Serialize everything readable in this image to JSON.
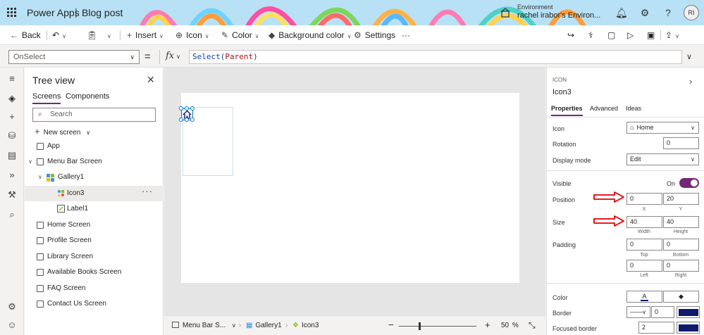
{
  "titlebar": {
    "app_name": "Power Apps",
    "separator": "|",
    "document": "Blog post",
    "environment_label": "Environment",
    "environment_name": "rachel irabor's Environ...",
    "avatar_initials": "RI"
  },
  "commandbar": {
    "back": "Back",
    "insert": "Insert",
    "icon": "Icon",
    "color": "Color",
    "background_color": "Background color",
    "settings": "Settings",
    "more": "···"
  },
  "formula_bar": {
    "property": "OnSelect",
    "equals": "=",
    "fx": "fx",
    "formula_fn": "Select(",
    "formula_arg": "Parent",
    "formula_close": ")"
  },
  "tree_view": {
    "title": "Tree view",
    "tabs": [
      "Screens",
      "Components"
    ],
    "search_placeholder": "Search",
    "new_screen": "New screen",
    "items": [
      {
        "label": "App"
      },
      {
        "label": "Menu Bar Screen"
      },
      {
        "label": "Gallery1"
      },
      {
        "label": "Icon3"
      },
      {
        "label": "Label1"
      },
      {
        "label": "Home Screen"
      },
      {
        "label": "Profile Screen"
      },
      {
        "label": "Library Screen"
      },
      {
        "label": "Available Books Screen"
      },
      {
        "label": "FAQ Screen"
      },
      {
        "label": "Contact Us Screen"
      }
    ]
  },
  "statusbar": {
    "crumb_screen": "Menu Bar S...",
    "crumb_gallery": "Gallery1",
    "crumb_icon": "Icon3",
    "zoom": "50",
    "zoom_unit": "%"
  },
  "properties": {
    "caption": "ICON",
    "control": "Icon3",
    "tabs": [
      "Properties",
      "Advanced",
      "Ideas"
    ],
    "icon_label": "Icon",
    "icon_value": "Home",
    "rotation_label": "Rotation",
    "rotation_value": "0",
    "display_mode_label": "Display mode",
    "display_mode_value": "Edit",
    "visible_label": "Visible",
    "visible_state": "On",
    "position_label": "Position",
    "position_x": "0",
    "position_y": "20",
    "x_label": "X",
    "y_label": "Y",
    "size_label": "Size",
    "width_value": "40",
    "height_value": "40",
    "width_label": "Width",
    "height_label": "Height",
    "padding_label": "Padding",
    "padding_top": "0",
    "padding_bottom": "0",
    "padding_left": "0",
    "padding_right": "0",
    "top_label": "Top",
    "bottom_label": "Bottom",
    "left_label": "Left",
    "right_label": "Right",
    "color_label": "Color",
    "border_label": "Border",
    "border_value": "0",
    "focused_border_label": "Focused border",
    "focused_border_value": "2",
    "accent_color": "#742774",
    "swatch_color": "#0d1a6e"
  }
}
